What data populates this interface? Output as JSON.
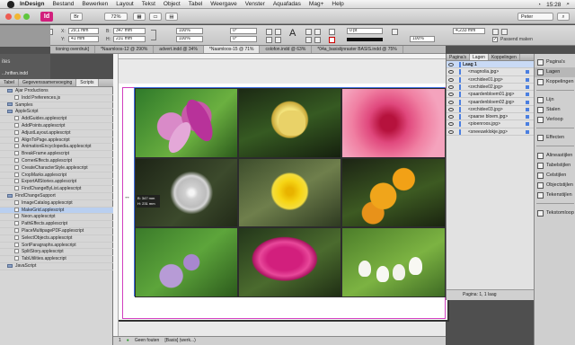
{
  "menubar": {
    "items": [
      "InDesign",
      "Bestand",
      "Bewerken",
      "Layout",
      "Tekst",
      "Object",
      "Tabel",
      "Weergave",
      "Venster",
      "Aquafadas",
      "Mag+",
      "Help"
    ],
    "time": "15:28",
    "user": "Peter"
  },
  "appbar": {
    "logo": "Id",
    "zoom": "72%",
    "workspace": "Peter"
  },
  "control": {
    "x": "29,1 mm",
    "y": "41 mm",
    "w": "347 mm",
    "h": "231 mm",
    "scale_x": "100%",
    "scale_y": "100%",
    "rotate": "0°",
    "shear": "0°",
    "stroke_weight": "0 pt",
    "tint": "100%",
    "ref": "4,233 mm",
    "auto_fit_label": "Passend maken",
    "auto_fit_checked": true
  },
  "tabs": [
    {
      "label": "tioning overdruk]",
      "active": false
    },
    {
      "label": "*Naamloos-12 @ 290%",
      "active": false
    },
    {
      "label": "advert.indd @ 34%",
      "active": false
    },
    {
      "label": "*Naamloos-15 @ 71%",
      "active": true
    },
    {
      "label": "colofon.indd @ 63%",
      "active": false
    },
    {
      "label": "*04a_basislijnraster BASIS.indd @ 75%",
      "active": false
    }
  ],
  "bg": {
    "text1": "ites",
    "text2": "...hriften.indd"
  },
  "left_panel": {
    "tabs": [
      "Tabel",
      "Gegevenssamenvoeging",
      "Scripts"
    ],
    "active_tab": "Scripts",
    "rows": [
      {
        "label": "Ajar Productions",
        "type": "folder",
        "selected": false
      },
      {
        "label": "Indd Preferences.js",
        "type": "file",
        "selected": false
      },
      {
        "label": "Samples",
        "type": "folder",
        "selected": false
      },
      {
        "label": "AppleScript",
        "type": "folder",
        "selected": false
      },
      {
        "label": "AddGuides.applescript",
        "type": "file",
        "selected": false
      },
      {
        "label": "AddPoints.applescript",
        "type": "file",
        "selected": false
      },
      {
        "label": "AdjustLayout.applescript",
        "type": "file",
        "selected": false
      },
      {
        "label": "AlignToPage.applescript",
        "type": "file",
        "selected": false
      },
      {
        "label": "AnimationEncyclopedia.applescript",
        "type": "file",
        "selected": false
      },
      {
        "label": "BreakFrame.applescript",
        "type": "file",
        "selected": false
      },
      {
        "label": "CornerEffects.applescript",
        "type": "file",
        "selected": false
      },
      {
        "label": "CreateCharacterStyle.applescript",
        "type": "file",
        "selected": false
      },
      {
        "label": "CropMarks.applescript",
        "type": "file",
        "selected": false
      },
      {
        "label": "ExportAllStories.applescript",
        "type": "file",
        "selected": false
      },
      {
        "label": "FindChangeByList.applescript",
        "type": "file",
        "selected": false
      },
      {
        "label": "FindChangeSupport",
        "type": "folder",
        "selected": false
      },
      {
        "label": "ImageCatalog.applescript",
        "type": "file",
        "selected": false
      },
      {
        "label": "MakeGrid.applescript",
        "type": "file",
        "selected": true
      },
      {
        "label": "Neon.applescript",
        "type": "file",
        "selected": false
      },
      {
        "label": "PathEffects.applescript",
        "type": "file",
        "selected": false
      },
      {
        "label": "PlaceMultipagePDF.applescript",
        "type": "file",
        "selected": false
      },
      {
        "label": "SelectObjects.applescript",
        "type": "file",
        "selected": false
      },
      {
        "label": "SortParagraphs.applescript",
        "type": "file",
        "selected": false
      },
      {
        "label": "SplitStory.applescript",
        "type": "file",
        "selected": false
      },
      {
        "label": "TabUtilities.applescript",
        "type": "file",
        "selected": false
      },
      {
        "label": "JavaScript",
        "type": "folder",
        "selected": false
      }
    ]
  },
  "tooltip": {
    "line1": "B: 347 mm",
    "line2": "H: 231 mm"
  },
  "status": {
    "page": "1",
    "error_label": "Geen fouten",
    "preflight": "[Basis] (werk...)"
  },
  "layers_panel": {
    "tabs": [
      "Pagina's",
      "Lagen",
      "Koppelingen"
    ],
    "active_tab": "Lagen",
    "layer": "Laag 1",
    "items": [
      "<magnolia.jpg>",
      "<orchidee01.jpg>",
      "<orchidee02.jpg>",
      "<paardenbloem01.jpg>",
      "<paardenbloem02.jpg>",
      "<orchidee03.jpg>",
      "<paarse bloem.jpg>",
      "<pioenroos.jpg>",
      "<sneeuwklokje.jpg>"
    ],
    "footer": "Pagina: 1, 1 laag"
  },
  "dock": {
    "items": [
      {
        "label": "Pagina's",
        "icon": "pages-icon",
        "active": false
      },
      {
        "label": "Lagen",
        "icon": "layers-icon",
        "active": true
      },
      {
        "label": "Koppelingen",
        "icon": "links-icon",
        "active": false
      },
      {
        "label": "Lijn",
        "icon": "stroke-icon",
        "active": false
      },
      {
        "label": "Stalen",
        "icon": "swatches-icon",
        "active": false
      },
      {
        "label": "Verloop",
        "icon": "gradient-icon",
        "active": false
      },
      {
        "label": "Effecten",
        "icon": "effects-icon",
        "active": false
      },
      {
        "label": "Alineastijlen",
        "icon": "paragraph-styles-icon",
        "active": false
      },
      {
        "label": "Tabelstijlen",
        "icon": "table-styles-icon",
        "active": false
      },
      {
        "label": "Celstijlen",
        "icon": "cell-styles-icon",
        "active": false
      },
      {
        "label": "Objectstijlen",
        "icon": "object-styles-icon",
        "active": false
      },
      {
        "label": "Tekenstijlen",
        "icon": "character-styles-icon",
        "active": false
      },
      {
        "label": "Tekstomloop",
        "icon": "text-wrap-icon",
        "active": false
      }
    ]
  },
  "colors": {
    "indesign_pink": "#d21f7d",
    "selection_blue": "#3d6fe0",
    "bleed_magenta": "#d13fbf"
  }
}
